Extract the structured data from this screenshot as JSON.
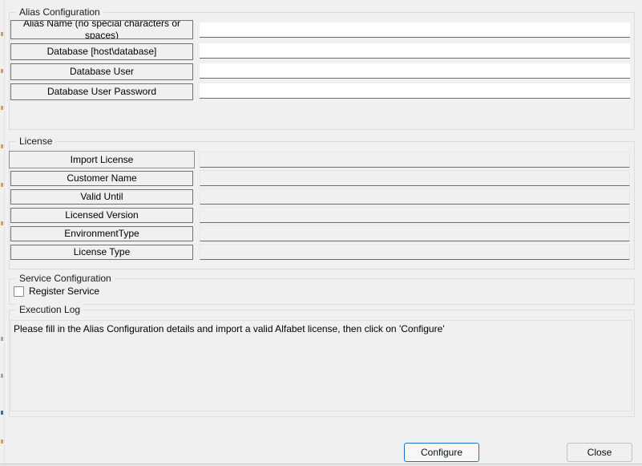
{
  "window": {
    "background_color": "#f0f0f0",
    "accent_color": "#1a73c4"
  },
  "alias_configuration": {
    "title": "Alias Configuration",
    "fields": [
      {
        "label": "Alias Name (no special characters or spaces)",
        "value": "",
        "placeholder": "",
        "disabled": false
      },
      {
        "label": "Database [host\\database]",
        "value": "",
        "placeholder": "",
        "disabled": false
      },
      {
        "label": "Database User",
        "value": "",
        "placeholder": "",
        "disabled": false
      },
      {
        "label": "Database User Password",
        "value": "",
        "placeholder": "",
        "disabled": false
      }
    ]
  },
  "license": {
    "title": "License",
    "fields": [
      {
        "label": "Import License",
        "value": "",
        "placeholder": "",
        "disabled": true
      },
      {
        "label": "Customer Name",
        "value": "",
        "placeholder": "",
        "disabled": true
      },
      {
        "label": "Valid Until",
        "value": "",
        "placeholder": "",
        "disabled": true
      },
      {
        "label": "Licensed Version",
        "value": "",
        "placeholder": "",
        "disabled": true
      },
      {
        "label": "EnvironmentType",
        "value": "",
        "placeholder": "",
        "disabled": true
      },
      {
        "label": "License Type",
        "value": "",
        "placeholder": "",
        "disabled": true
      }
    ]
  },
  "service_configuration": {
    "title": "Service Configuration",
    "register_service": {
      "label": "Register Service",
      "checked": false
    }
  },
  "execution_log": {
    "title": "Execution Log",
    "lines": [
      "Please fill in the Alias Configuration details and import a valid Alfabet license, then click on 'Configure'"
    ]
  },
  "footer": {
    "configure_label": "Configure",
    "close_label": "Close"
  }
}
